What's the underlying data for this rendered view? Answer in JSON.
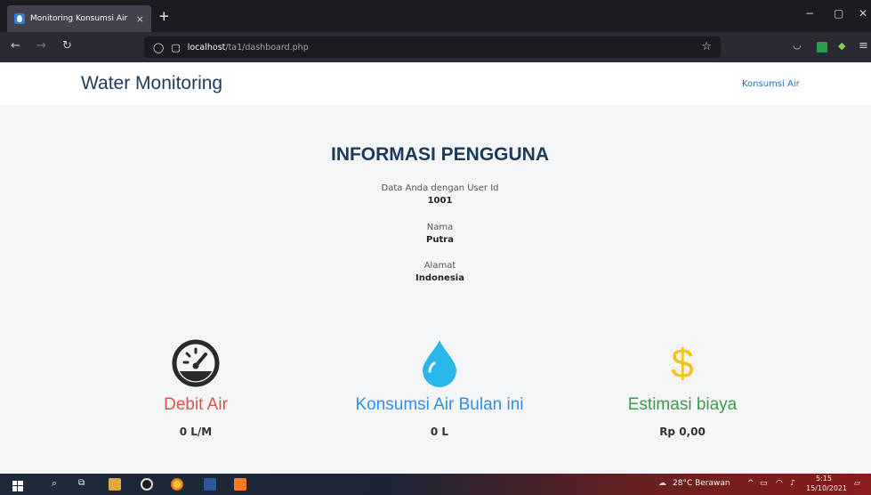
{
  "browser": {
    "tab_title": "Monitoring Konsumsi Air",
    "tab_close": "×",
    "new_tab": "+",
    "url_host": "localhost",
    "url_path": "/ta1/dashboard.php",
    "window_controls": [
      "−",
      "▢",
      "✕"
    ],
    "nav_icons": [
      "arrow-left-icon",
      "arrow-right-icon",
      "reload-icon"
    ]
  },
  "header": {
    "brand": "Water Monitoring",
    "nav_link": "Konsumsi Air"
  },
  "info": {
    "title": "INFORMASI PENGGUNA",
    "fields": [
      {
        "label": "Data Anda dengan User Id",
        "value": "1001"
      },
      {
        "label": "Nama",
        "value": "Putra"
      },
      {
        "label": "Alamat",
        "value": "Indonesia"
      }
    ]
  },
  "stats": [
    {
      "icon": "speedometer-icon",
      "title": "Debit Air",
      "value": "0 L/M",
      "color": "#d9534f"
    },
    {
      "icon": "water-drop-icon",
      "title": "Konsumsi Air Bulan ini",
      "value": "0 L",
      "color": "#2f8ee5"
    },
    {
      "icon": "dollar-icon",
      "title": "Estimasi biaya",
      "value": "Rp 0,00",
      "color": "#3c9a4a"
    }
  ],
  "colors": {
    "drop": "#29b6e8",
    "dollar": "#f7c21a",
    "gauge": "#2a2a2a"
  },
  "taskbar": {
    "weather": "28°C  Berawan",
    "time": "5:15",
    "date": "15/10/2021"
  }
}
